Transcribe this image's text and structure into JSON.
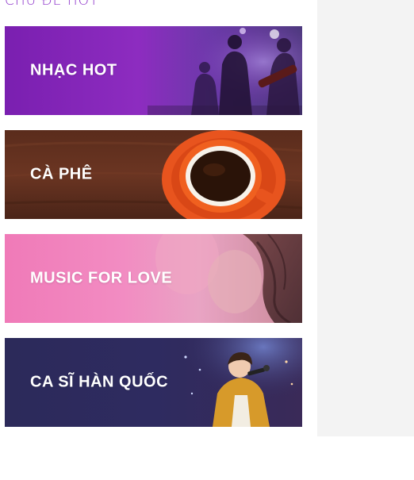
{
  "section": {
    "title": "CHỦ ĐỀ HOT"
  },
  "banners": [
    {
      "label": "NHẠC HOT"
    },
    {
      "label": "CÀ PHÊ"
    },
    {
      "label": "MUSIC FOR LOVE"
    },
    {
      "label": "CA SĨ HÀN QUỐC"
    }
  ]
}
